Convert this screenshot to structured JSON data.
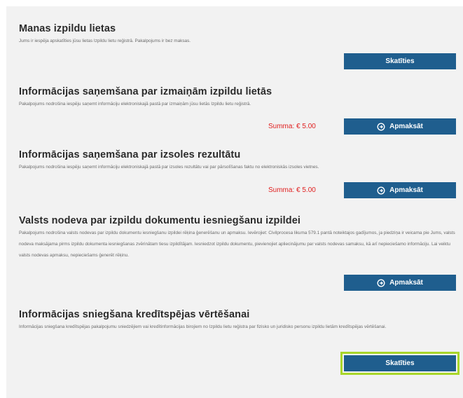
{
  "services": [
    {
      "title": "Manas izpildu lietas",
      "description": "Jums ir iespēja apskatīties jūsu lietas Izpildu lietu reģistrā. Pakalpojums ir bez maksas.",
      "button_label": "Skatīties"
    },
    {
      "title": "Informācijas saņemšana par izmaiņām izpildu lietās",
      "description": "Pakalpojums nodrošina iespēju saņemt informāciju elektroniskajā pastā par izmaiņām jūsu lietās Izpildu lietu reģistrā.",
      "price_label": "Summa: € 5.00",
      "button_label": "Apmaksāt",
      "button_icon": "pay-icon"
    },
    {
      "title": "Informācijas saņemšana par izsoles rezultātu",
      "description": "Pakalpojums nodrošina iespēju saņemt informāciju elektroniskajā pastā par izsoles rezultātu vai par pārsolīšanas faktu no elektroniskās izsoles vietnes.",
      "price_label": "Summa: € 5.00",
      "button_label": "Apmaksāt",
      "button_icon": "pay-icon"
    },
    {
      "title": "Valsts nodeva par izpildu dokumentu iesniegšanu izpildei",
      "description": "Pakalpojums nodrošina valsts nodevas par izpildu dokumentu iesniegšanu izpildei rēķina ģenerēšanu un apmaksu. Ievērojiet: Civilprocesa likuma 579.1 pantā noteiktajos gadījumos, ja piedziņa ir veicama pie Jums, valsts nodeva maksājama pirms izpildu dokumenta iesniegšanas zvērinātam tiesu izpildītājam. Iesniedzot izpildu dokumentu, pievienojiet apliecinājumu par valsts nodevas samaksu, kā arī nepieciešamo informāciju. Lai veiktu valsts nodevas apmaksu, nepieciešams ģenerēt rēķinu.",
      "button_label": "Apmaksāt",
      "button_icon": "pay-icon"
    },
    {
      "title": "Informācijas sniegšana kredītspējas vērtēšanai",
      "description": "Informācijas sniegšana kredītspējas pakalpojumu sniedzējiem vai kredītinformācijas birojiem no Izpildu lietu reģistra par fizisko un juridisko personu izpildu lietām kredītspējas vērtēšanai.",
      "button_label": "Skatīties"
    }
  ]
}
